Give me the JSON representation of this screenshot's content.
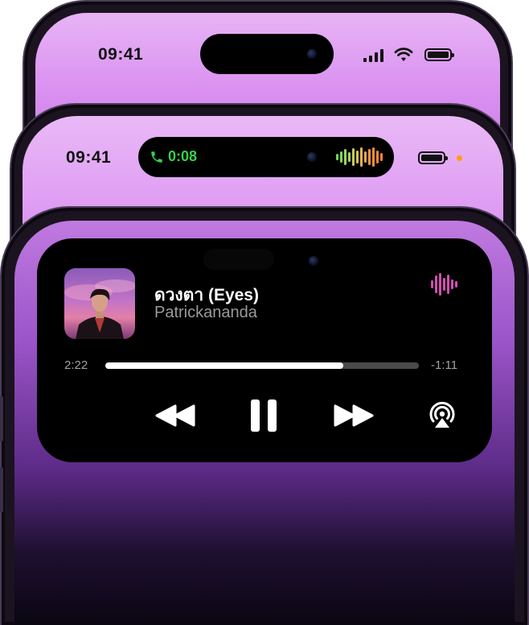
{
  "phone_top": {
    "time": "09:41"
  },
  "phone_middle": {
    "time": "09:41",
    "call_timer": "0:08",
    "icons": [
      "phone-icon",
      "audio-waveform-icon",
      "battery-icon",
      "privacy-indicator-dot"
    ],
    "colors": {
      "call_green": "#36d14a",
      "privacy_orange": "#ff9f0a"
    }
  },
  "now_playing": {
    "title": "ดวงตา (Eyes)",
    "artist": "Patrickananda",
    "elapsed": "2:22",
    "remaining": "-1:11",
    "progress": 0.76,
    "controls": [
      "rewind-icon",
      "pause-icon",
      "fast-forward-icon",
      "airplay-audio-icon"
    ],
    "colors": {
      "waveform_accent": "#d14fb0",
      "progress_fill": "#ffffff",
      "progress_track": "#4a4a4a"
    }
  }
}
